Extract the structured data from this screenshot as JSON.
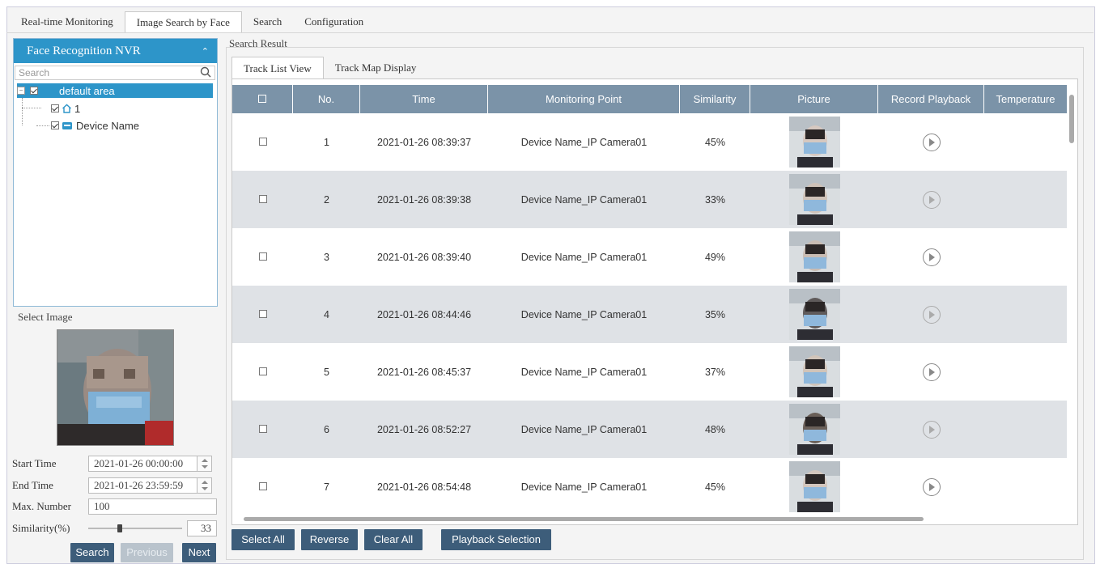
{
  "top_tabs": [
    "Real-time Monitoring",
    "Image Search by Face",
    "Search",
    "Configuration"
  ],
  "tree": {
    "title": "Face Recognition NVR",
    "search_placeholder": "Search",
    "nodes": [
      {
        "label": "default area",
        "checked": true,
        "selected": true
      },
      {
        "label": "1",
        "checked": true,
        "icon": "home-icon"
      },
      {
        "label": "Device Name",
        "checked": true,
        "icon": "nvr-device-icon"
      }
    ]
  },
  "select_image": {
    "title": "Select Image"
  },
  "form": {
    "start_time_label": "Start Time",
    "start_time": "2021-01-26 00:00:00",
    "end_time_label": "End Time",
    "end_time": "2021-01-26 23:59:59",
    "max_number_label": "Max. Number",
    "max_number": "100",
    "similarity_label": "Similarity(%)",
    "similarity": "33",
    "similarity_fraction": 0.33
  },
  "buttons": {
    "search": "Search",
    "previous": "Previous",
    "next": "Next"
  },
  "result": {
    "title": "Search Result",
    "tabs": [
      "Track List View",
      "Track Map Display"
    ],
    "columns": [
      "No.",
      "Time",
      "Monitoring Point",
      "Similarity",
      "Picture",
      "Record Playback",
      "Temperature"
    ],
    "rows": [
      {
        "no": "1",
        "time": "2021-01-26 08:39:37",
        "point": "Device Name_IP Camera01",
        "similarity": "45%"
      },
      {
        "no": "2",
        "time": "2021-01-26 08:39:38",
        "point": "Device Name_IP Camera01",
        "similarity": "33%"
      },
      {
        "no": "3",
        "time": "2021-01-26 08:39:40",
        "point": "Device Name_IP Camera01",
        "similarity": "49%"
      },
      {
        "no": "4",
        "time": "2021-01-26 08:44:46",
        "point": "Device Name_IP Camera01",
        "similarity": "35%"
      },
      {
        "no": "5",
        "time": "2021-01-26 08:45:37",
        "point": "Device Name_IP Camera01",
        "similarity": "37%"
      },
      {
        "no": "6",
        "time": "2021-01-26 08:52:27",
        "point": "Device Name_IP Camera01",
        "similarity": "48%"
      },
      {
        "no": "7",
        "time": "2021-01-26 08:54:48",
        "point": "Device Name_IP Camera01",
        "similarity": "45%"
      }
    ],
    "actions": [
      "Select All",
      "Reverse",
      "Clear All",
      "Playback Selection"
    ]
  },
  "colors": {
    "accent": "#2d95c9",
    "header": "#7b93a8",
    "button": "#3d5d7a"
  }
}
